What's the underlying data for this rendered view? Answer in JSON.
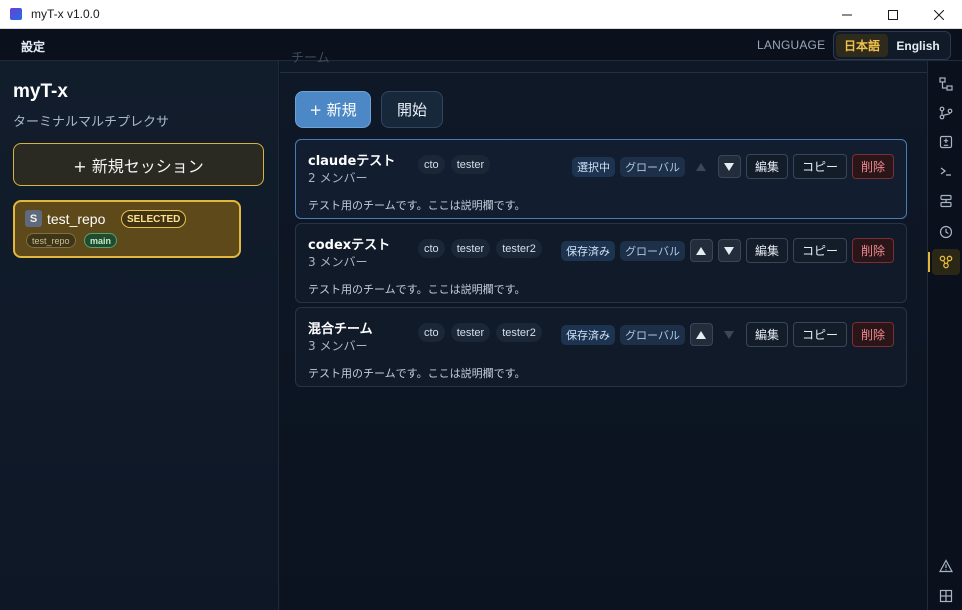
{
  "window": {
    "title": "myT-x v1.0.0"
  },
  "menubar": {
    "settings": "設定",
    "language_label": "LANGUAGE",
    "lang_ja": "日本語",
    "lang_en": "English",
    "active_lang": "日本語"
  },
  "sidebar": {
    "app_name": "myT-x",
    "app_subtitle": "ターミナルマルチプレクサ",
    "new_session": "+ 新規セッション",
    "sessions": [
      {
        "badge": "S",
        "name": "test_repo",
        "status": "SELECTED",
        "repo_tag": "test_repo",
        "branch_tag": "main"
      }
    ]
  },
  "main": {
    "ghost_title": "チーム",
    "new_button": "+ 新規",
    "start_button": "開始",
    "teams": [
      {
        "name": "claudeテスト",
        "members": "2 メンバー",
        "roles": [
          "cto",
          "tester"
        ],
        "state": "選択中",
        "scope": "グローバル",
        "can_up": false,
        "can_down": true,
        "edit": "編集",
        "copy": "コピー",
        "delete": "削除",
        "description": "テスト用のチームです。ここは説明欄です。"
      },
      {
        "name": "codexテスト",
        "members": "3 メンバー",
        "roles": [
          "cto",
          "tester",
          "tester2"
        ],
        "state": "保存済み",
        "scope": "グローバル",
        "can_up": true,
        "can_down": true,
        "edit": "編集",
        "copy": "コピー",
        "delete": "削除",
        "description": "テスト用のチームです。ここは説明欄です。"
      },
      {
        "name": "混合チーム",
        "members": "3 メンバー",
        "roles": [
          "cto",
          "tester",
          "tester2"
        ],
        "state": "保存済み",
        "scope": "グローバル",
        "can_up": true,
        "can_down": false,
        "edit": "編集",
        "copy": "コピー",
        "delete": "削除",
        "description": "テスト用のチームです。ここは説明欄です。"
      }
    ]
  },
  "rail": {
    "icons": [
      "file-tree-icon",
      "git-branch-icon",
      "diff-icon",
      "terminal-icon",
      "layers-icon",
      "history-icon",
      "team-icon"
    ],
    "bottom_icons": [
      "warning-icon",
      "grid-icon"
    ],
    "active": "team-icon"
  },
  "colors": {
    "accent": "#e2b83c",
    "primary": "#4c88c5",
    "danger": "#f08a8f"
  }
}
